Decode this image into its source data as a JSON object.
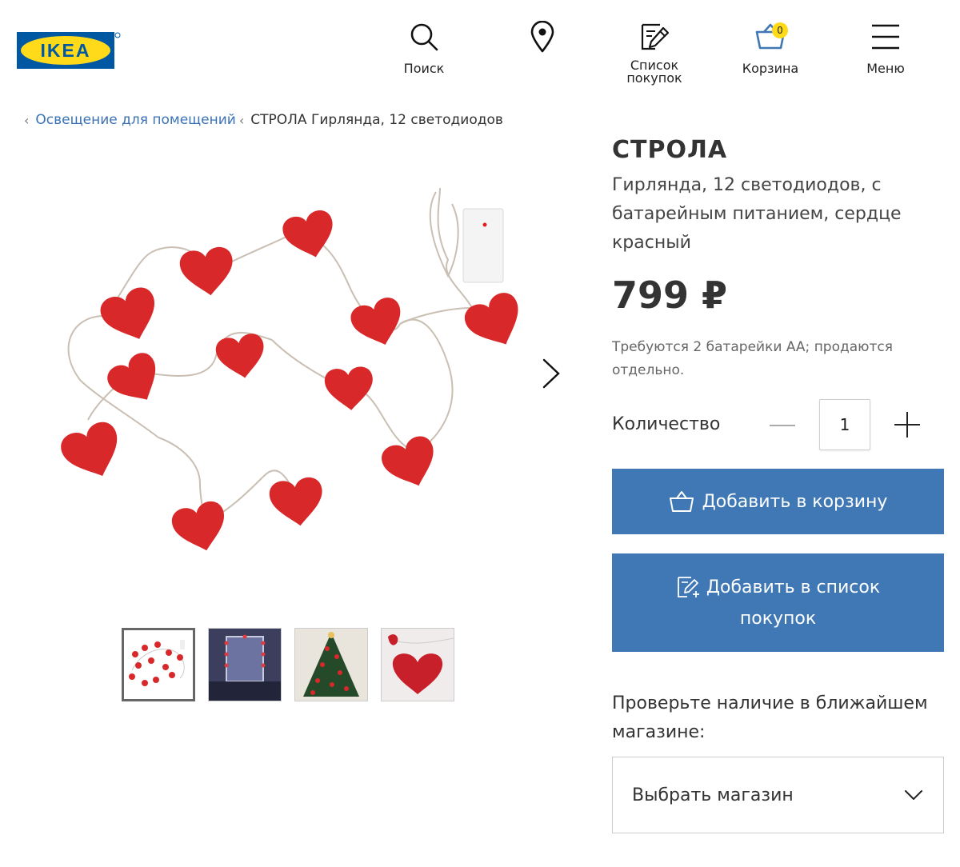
{
  "brand": {
    "logo_text": "IKEA"
  },
  "nav": {
    "search": "Поиск",
    "stores": "",
    "list_line1": "Список",
    "list_line2": "покупок",
    "cart": "Корзина",
    "cart_count": "0",
    "menu": "Меню"
  },
  "breadcrumb": {
    "parent": "Освещение для помещений",
    "current": "СТРОЛА Гирлянда, 12 светодиодов"
  },
  "product": {
    "name": "СТРОЛА",
    "description": "Гирлянда, 12 светодиодов, с батарейным питанием, сердце красный",
    "price": "799 ₽",
    "battery_note": "Требуются 2 батарейки AA; продаются отдельно.",
    "quantity_label": "Количество",
    "quantity_value": "1",
    "add_to_cart": "Добавить в корзину",
    "add_to_list_line1": "Добавить в список",
    "add_to_list_line2": "покупок",
    "stock_check": "Проверьте наличие в ближайшем магазине:",
    "select_store": "Выбрать магазин"
  },
  "gallery": {
    "thumbnails": [
      "product-photo",
      "mirror-room-photo",
      "christmas-tree-photo",
      "heart-closeup-photo"
    ],
    "active_index": 0
  },
  "colors": {
    "brand_blue": "#0058a3",
    "brand_yellow": "#ffda1a",
    "button_blue": "#3f78b4",
    "link_blue": "#3b72b4",
    "heart_red": "#d8282a"
  }
}
